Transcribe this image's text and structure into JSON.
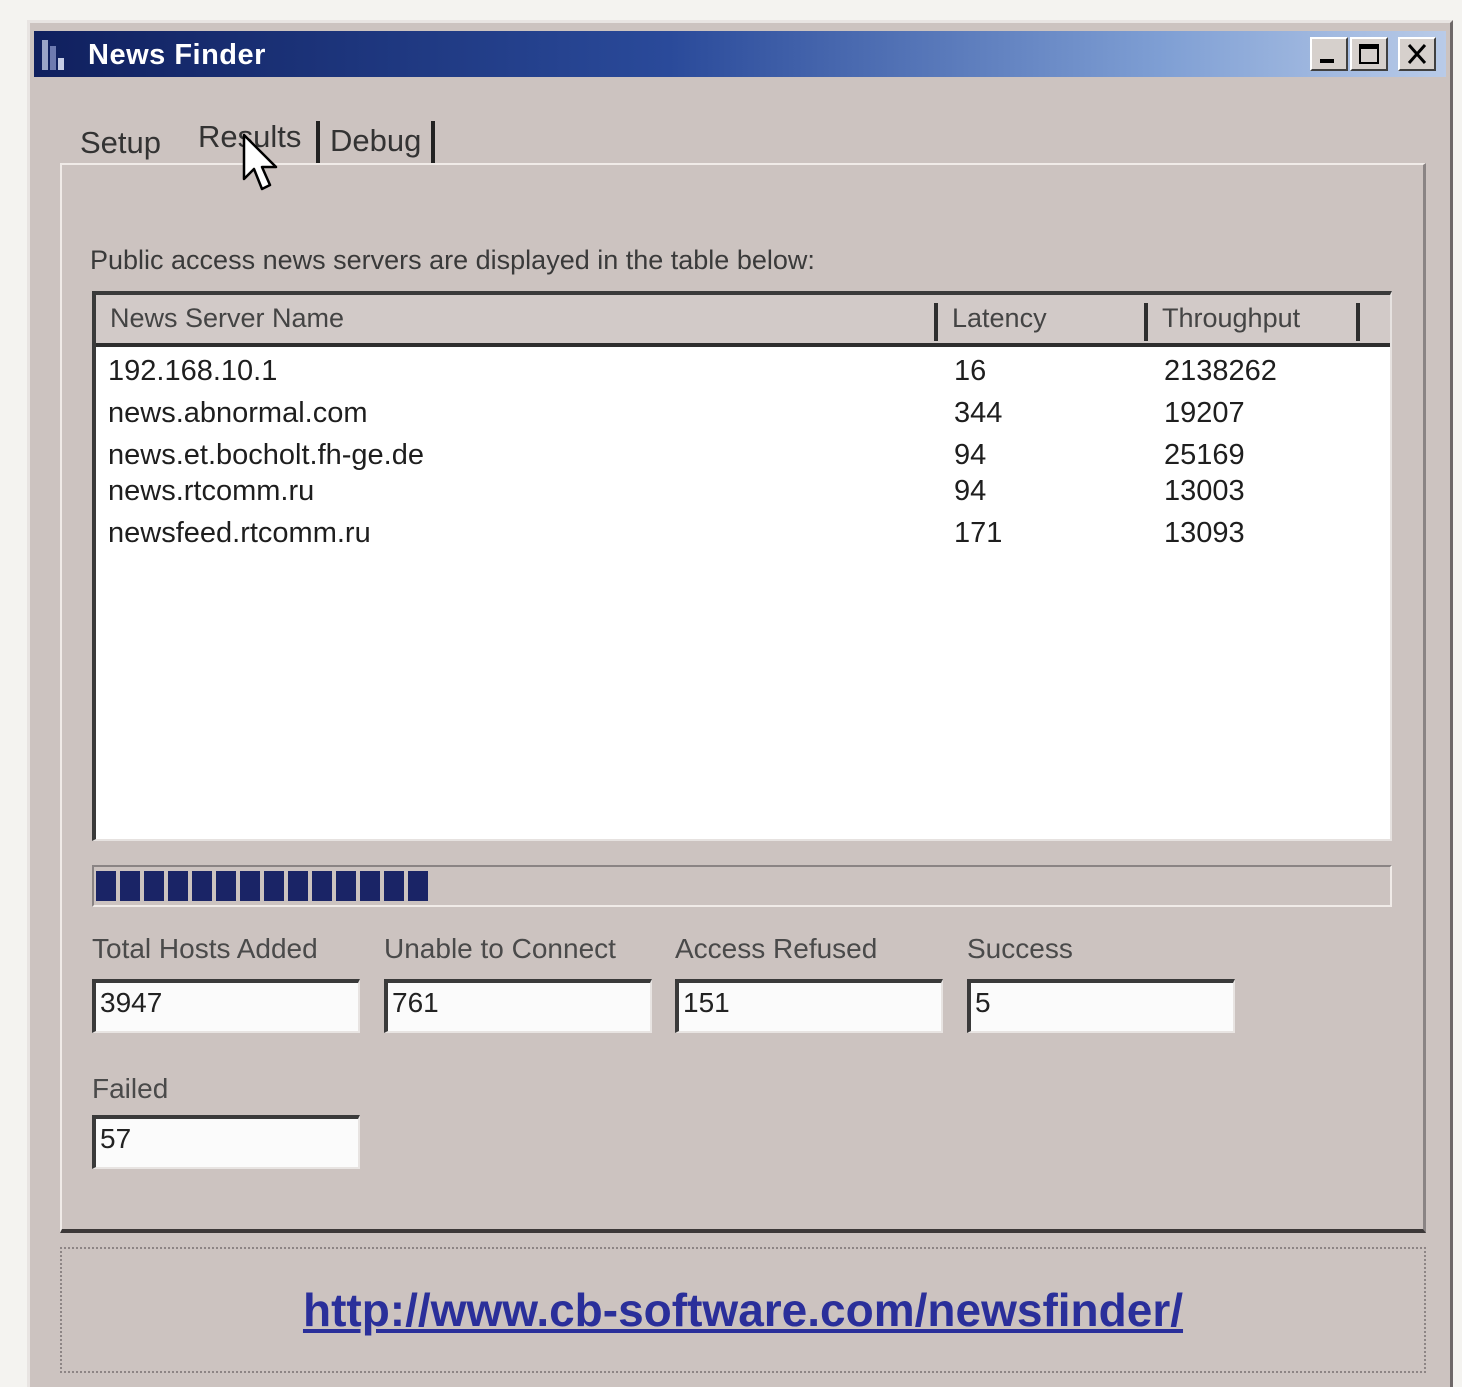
{
  "window": {
    "title": "News Finder"
  },
  "tabs": [
    {
      "label": "Setup"
    },
    {
      "label": "Results"
    },
    {
      "label": "Debug"
    }
  ],
  "results": {
    "caption": "Public access news servers are displayed in the table below:",
    "columns": {
      "name": "News Server Name",
      "latency": "Latency",
      "throughput": "Throughput"
    },
    "rows": [
      {
        "name": "192.168.10.1",
        "latency": "16",
        "throughput": "2138262"
      },
      {
        "name": "news.abnormal.com",
        "latency": "344",
        "throughput": "19207"
      },
      {
        "name": "news.et.bocholt.fh-ge.de",
        "latency": "94",
        "throughput": "25169"
      },
      {
        "name": "news.rtcomm.ru",
        "latency": "94",
        "throughput": "13003"
      },
      {
        "name": "newsfeed.rtcomm.ru",
        "latency": "171",
        "throughput": "13093"
      }
    ],
    "progress_fraction": 0.26
  },
  "stats": {
    "total_hosts_added": {
      "label": "Total Hosts Added",
      "value": "3947"
    },
    "unable_to_connect": {
      "label": "Unable to Connect",
      "value": "761"
    },
    "access_refused": {
      "label": "Access Refused",
      "value": "151"
    },
    "success": {
      "label": "Success",
      "value": "5"
    },
    "failed": {
      "label": "Failed",
      "value": "57"
    }
  },
  "footer": {
    "link": "http://www.cb-software.com/newsfinder/"
  },
  "colors": {
    "title_bar": "#10205e",
    "progress": "#1a2466",
    "link": "#2a2f9a"
  }
}
